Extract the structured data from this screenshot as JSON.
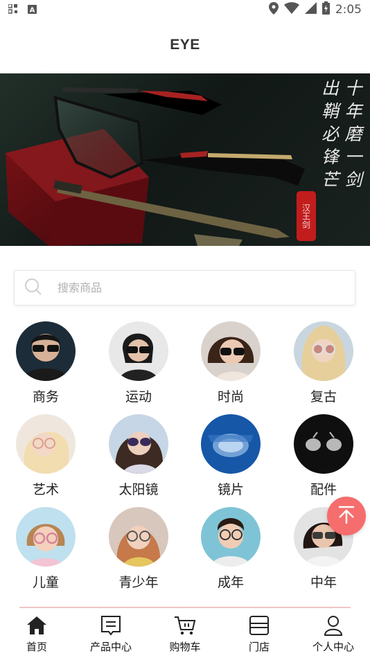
{
  "status_bar": {
    "time": "2:05",
    "left_icons": [
      "qr-scan-icon",
      "a-notification-icon"
    ],
    "right_icons": [
      "location-icon",
      "wifi-icon",
      "signal-icon",
      "battery-icon"
    ]
  },
  "header": {
    "title": "EYE"
  },
  "banner": {
    "poem_columns": [
      "十年磨一剑",
      "出鞘必锋芒"
    ],
    "seal_text": "汉王剑"
  },
  "search": {
    "placeholder": "搜索商品",
    "value": ""
  },
  "categories": [
    {
      "label": "商务"
    },
    {
      "label": "运动"
    },
    {
      "label": "时尚"
    },
    {
      "label": "复古"
    },
    {
      "label": "艺术"
    },
    {
      "label": "太阳镜"
    },
    {
      "label": "镜片"
    },
    {
      "label": "配件"
    },
    {
      "label": "儿童"
    },
    {
      "label": "青少年"
    },
    {
      "label": "成年"
    },
    {
      "label": "中年"
    }
  ],
  "tabbar": {
    "active": "home",
    "items": [
      {
        "label": "首页",
        "icon": "home-icon"
      },
      {
        "label": "产品中心",
        "icon": "product-list-icon"
      },
      {
        "label": "购物车",
        "icon": "cart-icon"
      },
      {
        "label": "门店",
        "icon": "store-icon"
      },
      {
        "label": "个人中心",
        "icon": "user-icon"
      }
    ]
  },
  "colors": {
    "accent": "#f56d6d",
    "tab_divider": "#f1c6c6",
    "banner_bg": "#141b18"
  }
}
